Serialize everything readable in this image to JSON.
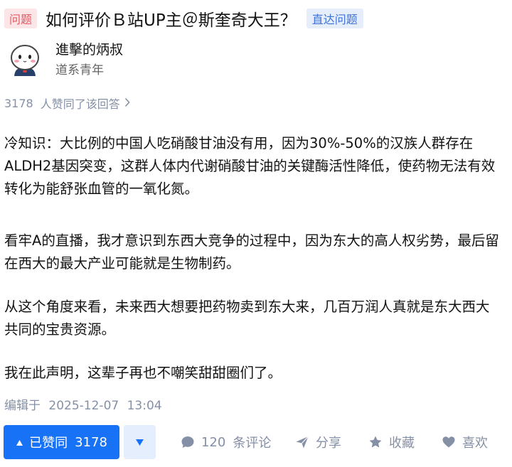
{
  "question": {
    "tag": "问题",
    "title": "如何评价Ｂ站UP主＠斯奎奇大王？",
    "go_label": "直达问题"
  },
  "author": {
    "name": "進擊的炳叔",
    "bio": "道系青年"
  },
  "likes_line": {
    "count": "3178",
    "text": "人赞同了该回答"
  },
  "answer": {
    "paragraphs": [
      "冷知识：大比例的中国人吃硝酸甘油没有用，因为30%-50%的汉族人群存在ALDH2基因突变，这群人体内代谢硝酸甘油的关键酶活性降低，使药物无法有效转化为能舒张血管的一氧化氮。",
      "看牢A的直播，我才意识到东西大竞争的过程中，因为东大的高人权劣势，最后留在西大的最大产业可能就是生物制药。",
      "从这个角度来看，未来西大想要把药物卖到东大来，几百万润人真就是东大西大共同的宝贵资源。",
      "我在此声明，这辈子再也不嘲笑甜甜圈们了。"
    ]
  },
  "edit": {
    "label": "编辑于",
    "date": "2025-12-07",
    "time": "13:04"
  },
  "actions": {
    "vote_up_label": "已赞同",
    "vote_up_count": "3178",
    "comment_count": "120",
    "comment_label": "条评论",
    "share_label": "分享",
    "favorite_label": "收藏",
    "like_label": "喜欢"
  },
  "colors": {
    "accent": "#1772f6",
    "muted": "#8590a6",
    "tag_bg": "#fbe5e6",
    "tag_text": "#e25a63"
  }
}
